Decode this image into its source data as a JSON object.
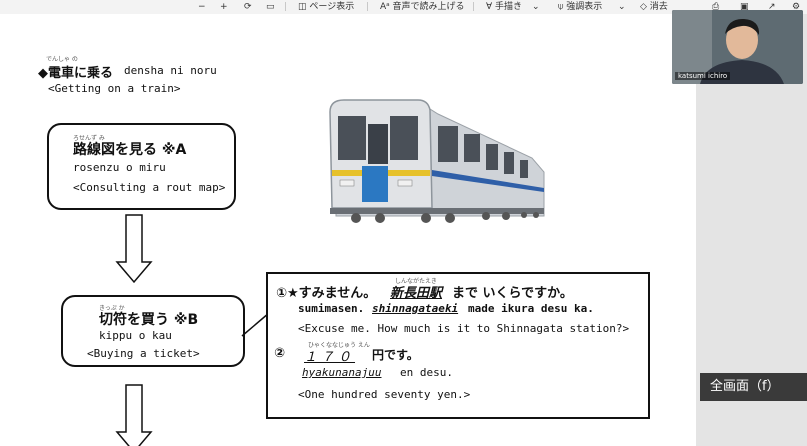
{
  "toolbar": {
    "minus": "−",
    "plus": "+",
    "page_view": "ページ表示",
    "read_aloud": "音声で読み上げる",
    "draw": "手描き",
    "highlight": "強調表示",
    "erase": "消去"
  },
  "heading": {
    "ruby": "でんしゃ の",
    "title_jp": "◆電車に乗る",
    "romaji": "densha ni noru",
    "english": "<Getting on a train>"
  },
  "step1": {
    "ruby": "ろせんず み",
    "title_jp": "路線図を見る  ※A",
    "romaji": "rosenzu o miru",
    "english": "<Consulting a rout map>"
  },
  "step2": {
    "ruby": "きっぷ か",
    "title_jp": "切符を買う  ※B",
    "romaji": "kippu o kau",
    "english": "<Buying a ticket>"
  },
  "dialog": {
    "l1_prefix": "①★すみません。",
    "l1_station_ruby": "しんながたえき",
    "l1_station": "新長田駅",
    "l1_suffix": "まで いくらですか。",
    "l2_a": "sumimasen.",
    "l2_station": "shinnagataeki",
    "l2_b": "made ikura desu ka.",
    "l3": "<Excuse me. How much is it to Shinnagata station?>",
    "l4_num": "②",
    "l4_price_ruby": "ひゃくななじゅう   えん",
    "l4_price": "１７０",
    "l4_suffix": "円です。",
    "l5_price": "hyakunanajuu",
    "l5_suffix": "en desu.",
    "l6": "<One hundred seventy yen.>"
  },
  "webcam": {
    "name": "katsumi ichiro"
  },
  "fullscreen": {
    "label": "全画面（f）"
  }
}
